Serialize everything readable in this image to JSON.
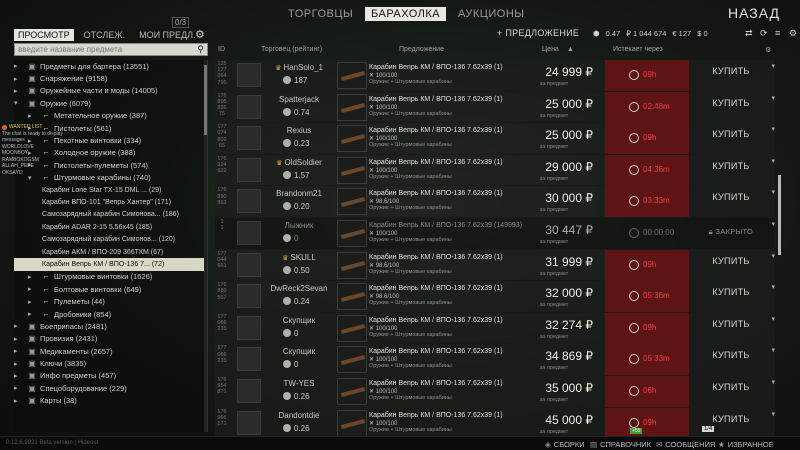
{
  "topnav": {
    "tabs": [
      "ТОРГОВЦЫ",
      "БАРАХОЛКА",
      "АУКЦИОНЫ"
    ],
    "active_tab": "БАРАХОЛКА",
    "back_label": "НАЗАД"
  },
  "left": {
    "tabs": [
      "ПРОСМОТР",
      "ОТСЛЕЖ.",
      "МОИ ПРЕДЛ."
    ],
    "offers_count_badge": "0/3",
    "search_placeholder": "введите название предмета",
    "categories": [
      {
        "level": 0,
        "label": "Предметы для бартера (13551)"
      },
      {
        "level": 0,
        "label": "Снаряжение (9158)"
      },
      {
        "level": 0,
        "label": "Оружейные части и моды (14005)"
      },
      {
        "level": 0,
        "label": "Оружие (6079)",
        "expanded": true
      },
      {
        "level": 1,
        "label": "Метательное оружие (387)"
      },
      {
        "level": 1,
        "label": "Пистолеты (561)"
      },
      {
        "level": 1,
        "label": "Пехотные винтовки (334)"
      },
      {
        "level": 1,
        "label": "Холодное оружие (388)"
      },
      {
        "level": 1,
        "label": "Пистолеты-пулеметы (574)"
      },
      {
        "level": 1,
        "label": "Штурмовые карабины (740)",
        "expanded": true
      },
      {
        "level": 2,
        "label": "Карабин Lone Star TX-15 DML ... (29)"
      },
      {
        "level": 2,
        "label": "Карабин ВПО-101 \"Вепрь Хантер\" (171)"
      },
      {
        "level": 2,
        "label": "Самозарядный карабин Симонова... (186)"
      },
      {
        "level": 2,
        "label": "Карабин ADAR 2-15 5.56x45 (185)"
      },
      {
        "level": 2,
        "label": "Самозарядный карабин Симонов... (120)"
      },
      {
        "level": 2,
        "label": "Карабин АКМ / ВПО-209 366ТКМ (67)"
      },
      {
        "level": 2,
        "label": "Карабин Вепрь КМ / ВПО-136 7... (72)",
        "selected": true
      },
      {
        "level": 1,
        "label": "Штурмовые винтовки (1626)"
      },
      {
        "level": 1,
        "label": "Болтовые винтовки (649)"
      },
      {
        "level": 1,
        "label": "Пулеметы (44)"
      },
      {
        "level": 1,
        "label": "Дробовики (854)"
      },
      {
        "level": 0,
        "label": "Боеприпасы (2481)"
      },
      {
        "level": 0,
        "label": "Провизия (2431)"
      },
      {
        "level": 0,
        "label": "Медикаменты (2657)"
      },
      {
        "level": 0,
        "label": "Ключи (3835)"
      },
      {
        "level": 0,
        "label": "Инфо предметы (457)"
      },
      {
        "level": 0,
        "label": "Спецоборудование (229)"
      },
      {
        "level": 0,
        "label": "Карты (38)"
      }
    ]
  },
  "chat": {
    "title": "WANTED LIST",
    "message": "The chat is ready to display messages",
    "lines": [
      "WORLDLOVE",
      "MOONBOY",
      "RAMBOKOGSM",
      "ALLAH_PEPE",
      "OKSAYD"
    ]
  },
  "header": {
    "add_offer_label": "+ ПРЕДЛОЖЕНИЕ",
    "rating_value": "0.47",
    "roubles": "₽ 1 044 674",
    "euros": "€ 127",
    "dollars": "$ 0"
  },
  "columns": {
    "id": "ID",
    "trader": "Торговец (рейтинг)",
    "offer": "Предложение",
    "price": "Цена",
    "expires": "Истекает через"
  },
  "offers": [
    {
      "id": [
        "125",
        "177",
        "064",
        "795"
      ],
      "trader": "HanSolo_1",
      "crown": true,
      "rating": "187",
      "item": "Карабин Вепрь КМ / ВПО-136 7.62x39 (1)",
      "dur": "100/100",
      "req": "Оружие + Штурмовые карабины",
      "price": "24 999 ₽",
      "price_sub": "за предмет",
      "time": "09h",
      "buy": "КУПИТЬ",
      "closed": false
    },
    {
      "id": [
        "176",
        "895",
        "836",
        "75"
      ],
      "trader": "Spatterjack",
      "crown": false,
      "rating": "0.74",
      "item": "Карабин Вепрь КМ / ВПО-136 7.62x39 (1)",
      "dur": "100/100",
      "req": "Оружие + Штурмовые карабины",
      "price": "25 000 ₽",
      "price_sub": "за предмет",
      "time": "02:48m",
      "buy": "КУПИТЬ",
      "closed": false
    },
    {
      "id": [
        "177",
        "074",
        "802",
        "65"
      ],
      "trader": "Rexius",
      "crown": false,
      "rating": "0.23",
      "item": "Карабин Вепрь КМ / ВПО-136 7.62x39 (1)",
      "dur": "100/100",
      "req": "Оружие + Штурмовые карабины",
      "price": "25 000 ₽",
      "price_sub": "за предмет",
      "time": "09h",
      "buy": "КУПИТЬ",
      "closed": false
    },
    {
      "id": [
        "176",
        "924",
        "622"
      ],
      "trader": "OldSoldier",
      "crown": true,
      "rating": "1.57",
      "item": "Карабин Вепрь КМ / ВПО-136 7.62x39 (1)",
      "dur": "100/100",
      "req": "Оружие + Штурмовые карабины",
      "price": "29 000 ₽",
      "price_sub": "за предмет",
      "time": "04:36m",
      "buy": "КУПИТЬ",
      "closed": false
    },
    {
      "id": [
        "176",
        "890",
        "863"
      ],
      "trader": "Brandonm21",
      "crown": false,
      "rating": "0.20",
      "item": "Карабин Вепрь КМ / ВПО-136 7.62x39 (1)",
      "dur": "98.6/100",
      "req": "Оружие + Штурмовые карабины",
      "price": "30 000 ₽",
      "price_sub": "за предмет",
      "time": "03:33m",
      "buy": "КУПИТЬ",
      "closed": false
    },
    {
      "id": [
        "1",
        "1"
      ],
      "trader": "Лыжник",
      "crown": false,
      "rating": "0",
      "item": "Карабин Вепрь КМ / ВПО-136 7.62x39 (149993)",
      "dur": "100/100",
      "req": "Оружие + Штурмовые карабины",
      "price": "30 447 ₽",
      "price_sub": "за предмет",
      "time": "00:00:00",
      "buy": "ЗАКРЫТО",
      "closed": true
    },
    {
      "id": [
        "177",
        "044",
        "661"
      ],
      "trader": "SKULL",
      "crown": true,
      "rating": "0.50",
      "item": "Карабин Вепрь КМ / ВПО-136 7.62x39 (1)",
      "dur": "98.6/100",
      "req": "Оружие + Штурмовые карабины",
      "price": "31 999 ₽",
      "price_sub": "за предмет",
      "time": "09h",
      "buy": "КУПИТЬ",
      "closed": false
    },
    {
      "id": [
        "176",
        "880",
        "567"
      ],
      "trader": "DwReck2Sevan",
      "crown": false,
      "rating": "0.24",
      "item": "Карабин Вепрь КМ / ВПО-136 7.62x39 (1)",
      "dur": "98.6/100",
      "req": "Оружие + Штурмовые карабины",
      "price": "32 000 ₽",
      "price_sub": "за предмет",
      "time": "05:36m",
      "buy": "КУПИТЬ",
      "closed": false
    },
    {
      "id": [
        "177",
        "086",
        "235"
      ],
      "trader": "Скупщик",
      "crown": false,
      "rating": "0",
      "item": "Карабин Вепрь КМ / ВПО-136 7.62x39 (1)",
      "dur": "100/100",
      "req": "Оружие + Штурмовые карабины",
      "price": "32 274 ₽",
      "price_sub": "за предмет",
      "time": "09h",
      "buy": "КУПИТЬ",
      "closed": false
    },
    {
      "id": [
        "177",
        "086",
        "235"
      ],
      "trader": "Скупщик",
      "crown": false,
      "rating": "0",
      "item": "Карабин Вепрь КМ / ВПО-136 7.62x39 (1)",
      "dur": "100/100",
      "req": "Оружие + Штурмовые карабины",
      "price": "34 869 ₽",
      "price_sub": "за предмет",
      "time": "05:33m",
      "buy": "КУПИТЬ",
      "closed": false
    },
    {
      "id": [
        "176",
        "954",
        "871"
      ],
      "trader": "TW-YES",
      "crown": false,
      "rating": "0.26",
      "item": "Карабин Вепрь КМ / ВПО-136 7.62x39 (1)",
      "dur": "100/100",
      "req": "Оружие + Штурмовые карабины",
      "price": "35 000 ₽",
      "price_sub": "за предмет",
      "time": "06h",
      "buy": "КУПИТЬ",
      "closed": false
    },
    {
      "id": [
        "176",
        "966",
        "171"
      ],
      "trader": "Dandontdie",
      "crown": false,
      "rating": "0.26",
      "item": "Карабин Вепрь КМ / ВПО-136 7.62x39 (1)",
      "dur": "100/100",
      "req": "Оружие + Штурмовые карабины",
      "price": "45 000 ₽",
      "price_sub": "за предмет",
      "time": "09h",
      "buy": "КУПИТЬ",
      "closed": false
    }
  ],
  "bottombar": {
    "version": "0.12.6.9921 Beta version | Hideout",
    "items": [
      "СБОРКИ",
      "СПРАВОЧНИК",
      "СООБЩЕНИЯ",
      "ИЗБРАННОЕ"
    ],
    "green_badge": "+55",
    "page_badge": "1/4"
  }
}
